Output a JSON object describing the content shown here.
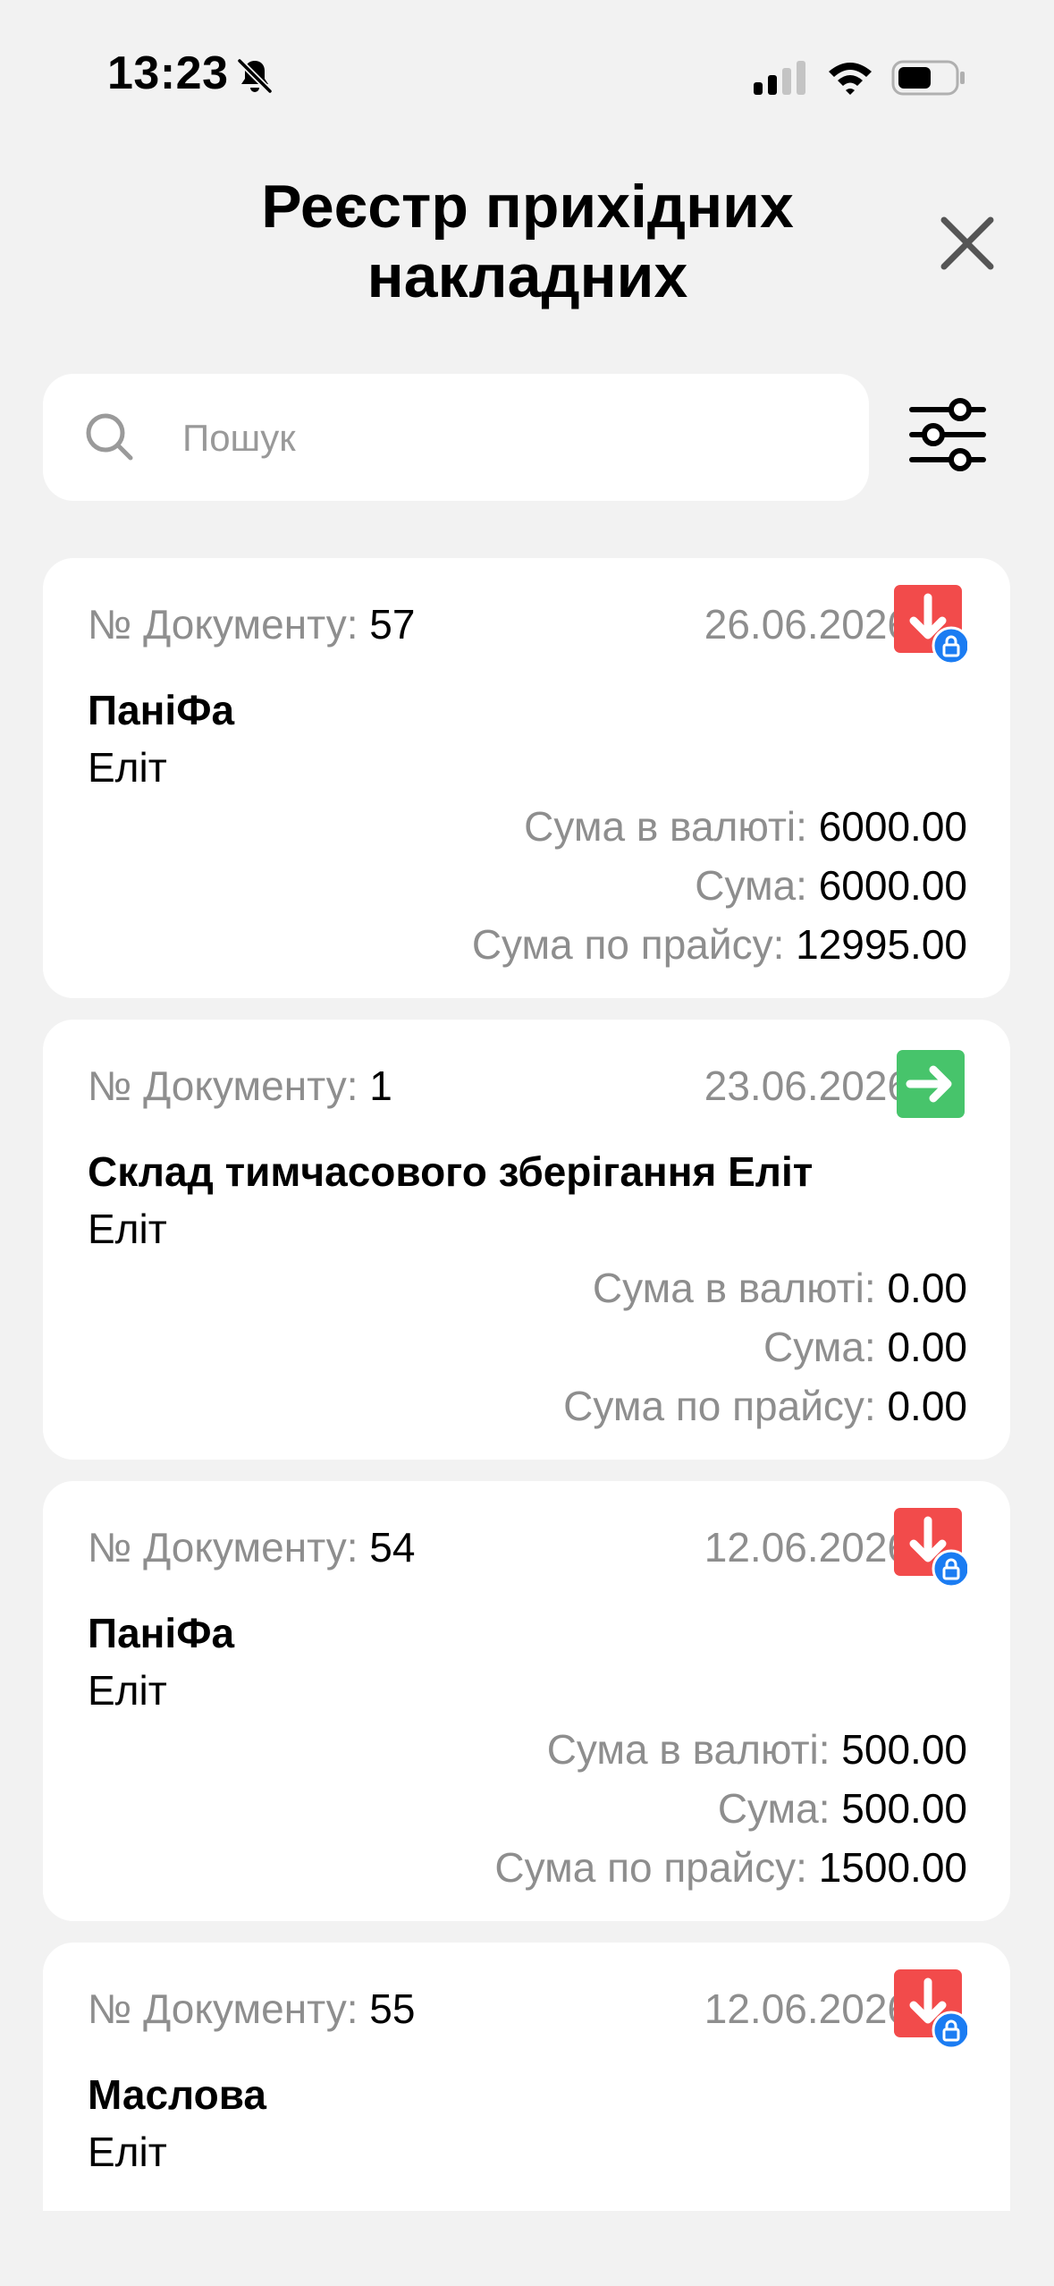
{
  "status_bar": {
    "time": "13:23"
  },
  "header": {
    "title_line1": "Реєстр прихідних",
    "title_line2": "накладних"
  },
  "search": {
    "placeholder": "Пошук",
    "value": ""
  },
  "labels": {
    "doc_number": "№ Документу: ",
    "sum_currency": "Сума в валюті: ",
    "sum": "Сума: ",
    "sum_price": "Сума по прайсу: "
  },
  "colors": {
    "incoming_locked": "#f24b4b",
    "moved": "#47c46b",
    "lock_badge": "#1b7cf2"
  },
  "invoices": [
    {
      "number": "57",
      "date": "26.06.2026",
      "status_icon": "incoming-locked-icon",
      "supplier": "ПаніФа",
      "warehouse": "Еліт",
      "sum_currency": "6000.00",
      "sum": "6000.00",
      "sum_price": "12995.00"
    },
    {
      "number": "1",
      "date": "23.06.2026",
      "status_icon": "transfer-arrow-icon",
      "supplier": "Склад тимчасового зберігання Еліт",
      "warehouse": "Еліт",
      "sum_currency": "0.00",
      "sum": "0.00",
      "sum_price": "0.00"
    },
    {
      "number": "54",
      "date": "12.06.2026",
      "status_icon": "incoming-locked-icon",
      "supplier": "ПаніФа",
      "warehouse": "Еліт",
      "sum_currency": "500.00",
      "sum": "500.00",
      "sum_price": "1500.00"
    },
    {
      "number": "55",
      "date": "12.06.2026",
      "status_icon": "incoming-locked-icon",
      "supplier": "Маслова",
      "warehouse": "Еліт"
    }
  ]
}
